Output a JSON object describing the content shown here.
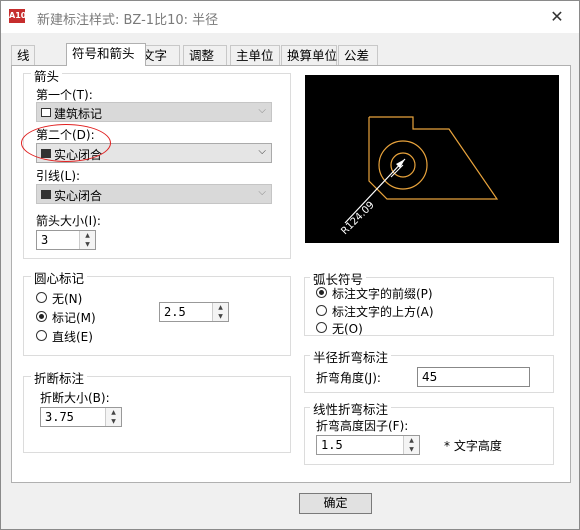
{
  "window": {
    "title": "新建标注样式: BZ-1比10: 半径",
    "close_symbol": "✕",
    "icon_text": "A10"
  },
  "tabs": [
    "线",
    "符号和箭头",
    "文字",
    "调整",
    "主单位",
    "换算单位",
    "公差"
  ],
  "arrowheads": {
    "group_label": "箭头",
    "first": {
      "label": "第一个(T):",
      "value": "建筑标记"
    },
    "second": {
      "label": "第二个(D):",
      "value": "实心闭合"
    },
    "leader": {
      "label": "引线(L):",
      "value": "实心闭合"
    },
    "size": {
      "label": "箭头大小(I):",
      "value": "3"
    }
  },
  "center_marks": {
    "group_label": "圆心标记",
    "options": [
      "无(N)",
      "标记(M)",
      "直线(E)"
    ],
    "selected": 1,
    "size_value": "2.5"
  },
  "dim_break": {
    "group_label": "折断标注",
    "size_label": "折断大小(B):",
    "size_value": "3.75"
  },
  "preview": {
    "dimension_text": "R124.09",
    "line_color": "#e8a33c"
  },
  "arc_length": {
    "group_label": "弧长符号",
    "options": [
      "标注文字的前缀(P)",
      "标注文字的上方(A)",
      "无(O)"
    ],
    "selected": 0
  },
  "radius_jog": {
    "group_label": "半径折弯标注",
    "angle_label": "折弯角度(J):",
    "angle_value": "45"
  },
  "linear_jog": {
    "group_label": "线性折弯标注",
    "factor_label": "折弯高度因子(F):",
    "factor_value": "1.5",
    "suffix": "* 文字高度"
  },
  "ok_button": "确定",
  "colors": {
    "annotation_circle": "#e02020",
    "preview_background": "#000000"
  }
}
